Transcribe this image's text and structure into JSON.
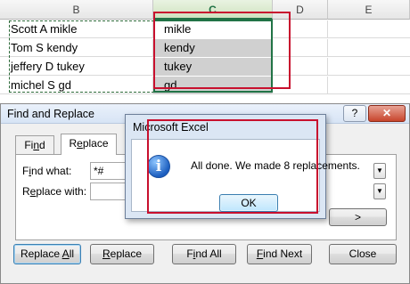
{
  "sheet": {
    "columns": [
      "B",
      "C",
      "D",
      "E"
    ],
    "rows": [
      {
        "b": "Scott A mikle",
        "c": "mikle"
      },
      {
        "b": "Tom S kendy",
        "c": "kendy"
      },
      {
        "b": "jeffery D tukey",
        "c": "tukey"
      },
      {
        "b": "michel S gd",
        "c": "gd"
      }
    ]
  },
  "find_replace": {
    "title": "Find and Replace",
    "help_label": "?",
    "close_label": "✕",
    "tabs": [
      "Find",
      "Replace"
    ],
    "active_tab": "Replace",
    "find_what_label": "Find what:",
    "find_what_value": "*#",
    "replace_with_label": "Replace with:",
    "replace_with_value": "",
    "buttons": {
      "replace_all": "Replace All",
      "replace": "Replace",
      "find_all": "Find All",
      "find_next": "Find Next",
      "close": "Close"
    }
  },
  "message_box": {
    "title": "Microsoft Excel",
    "icon": "info-icon",
    "message": "All done. We made 8 replacements.",
    "ok_label": "OK"
  },
  "colors": {
    "selection_border": "#217346",
    "annotation_red": "#c8102e",
    "selected_cell_fill": "#d0d0d0"
  }
}
